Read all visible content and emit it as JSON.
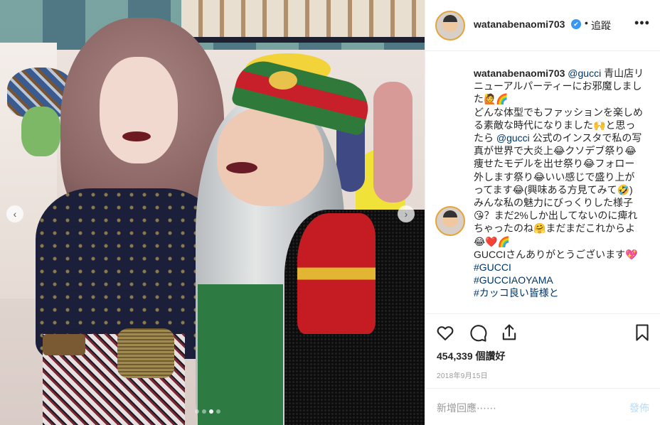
{
  "photo": {
    "alt_subjects": [
      "left-model",
      "right-model"
    ],
    "carousel": {
      "count": 4,
      "active_index": 2
    }
  },
  "header": {
    "username": "watanabenaomi703",
    "verified": "✔",
    "separator": "•",
    "follow_label": "追蹤",
    "more_label": "•••"
  },
  "caption": {
    "username": "watanabenaomi703",
    "mention": "@gucci",
    "text_1": " 青山店リニューアルパーティーにお邪魔しました🙋🌈",
    "text_2": "どんな体型でもファッションを楽しめる素敵な時代になりました🙌と思ったら ",
    "mention_2": "@gucci",
    "text_3": " 公式のインスタで私の写真が世界で大炎上😂クソデブ祭り😂痩せたモデルを出せ祭り😂フォロー外します祭り😂いい感じで盛り上がってます😂(興味ある方見てみて🤣)",
    "text_4": "みんな私の魅力にびっくりした様子😘？まだ2%しか出してないのに痺れちゃったのね🤗まだまだこれからよ😂❤️🌈",
    "text_5": "GUCCIさんありがとうございます💖",
    "hashtags": [
      "#GUCCI",
      "#GUCCIAOYAMA",
      "#カッコ良い皆様と"
    ]
  },
  "actions": {
    "likes": "454,339 個讚好",
    "date": "2018年9月15日"
  },
  "comment_box": {
    "placeholder": "新增回應⋯⋯",
    "post_label": "發佈"
  },
  "colors": {
    "link": "#003569",
    "verified": "#3897f0",
    "post_disabled": "#b2dffc",
    "muted": "#999999"
  }
}
